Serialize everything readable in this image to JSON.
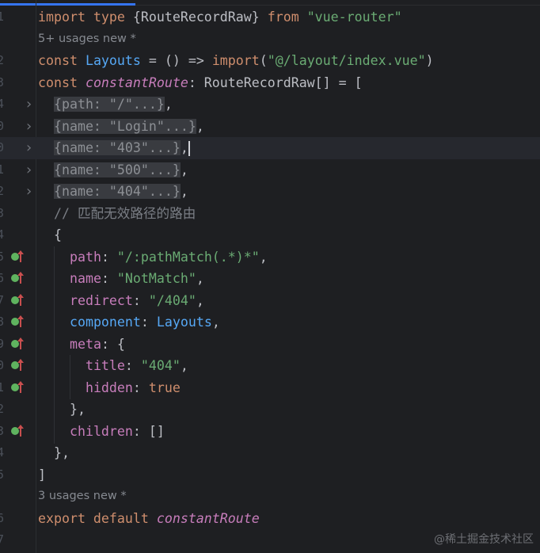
{
  "editor": {
    "colors": {
      "background": "#1e1f22",
      "keyword": "#cf8e6d",
      "string": "#6aab73",
      "property": "#c77dbb",
      "identifier": "#56a8f5",
      "text": "#bcbec4"
    },
    "lines": [
      {
        "ln": "1",
        "tokens": [
          [
            "import type ",
            "kw"
          ],
          [
            "{RouteRecordRaw} ",
            ""
          ],
          [
            "from ",
            "kw"
          ],
          [
            "\"vue-router\"",
            "str"
          ]
        ]
      },
      {
        "hint": "5+ usages   new *"
      },
      {
        "ln": "2",
        "tokens": [
          [
            "const ",
            "kw"
          ],
          [
            "Layouts",
            "fn"
          ],
          [
            " = () => ",
            ""
          ],
          [
            "import",
            "kw"
          ],
          [
            "(",
            ""
          ],
          [
            "\"@/layout/index.vue\"",
            "str"
          ],
          [
            ")",
            ""
          ]
        ]
      },
      {
        "ln": "3",
        "tokens": [
          [
            "const ",
            "kw"
          ],
          [
            "constantRoute",
            "ital"
          ],
          [
            ": RouteRecordRaw[] = [",
            ""
          ]
        ]
      },
      {
        "ln": "4",
        "fold": true,
        "tokens": [
          [
            "  ",
            ""
          ],
          [
            "{path: \"/\"...}",
            "fold-block"
          ],
          [
            ",",
            ""
          ]
        ]
      },
      {
        "ln": "0",
        "fold": true,
        "tokens": [
          [
            "  ",
            ""
          ],
          [
            "{name: \"Login\"...}",
            "fold-block"
          ],
          [
            ",",
            ""
          ]
        ]
      },
      {
        "ln": "0",
        "fold": true,
        "current": true,
        "caret": true,
        "tokens": [
          [
            "  ",
            ""
          ],
          [
            "{name: \"403\"...}",
            "fold-block"
          ],
          [
            ",",
            ""
          ]
        ]
      },
      {
        "ln": "1",
        "fold": true,
        "tokens": [
          [
            "  ",
            ""
          ],
          [
            "{name: \"500\"...}",
            "fold-block"
          ],
          [
            ",",
            ""
          ]
        ]
      },
      {
        "ln": "2",
        "fold": true,
        "tokens": [
          [
            "  ",
            ""
          ],
          [
            "{name: \"404\"...}",
            "fold-block"
          ],
          [
            ",",
            ""
          ]
        ]
      },
      {
        "ln": "3",
        "tokens": [
          [
            "  // 匹配无效路径的路由",
            "cm"
          ]
        ]
      },
      {
        "ln": "4",
        "tokens": [
          [
            "  {",
            ""
          ]
        ]
      },
      {
        "ln": "5",
        "impl": true,
        "tokens": [
          [
            "    ",
            ""
          ],
          [
            "path",
            "prop"
          ],
          [
            ": ",
            ""
          ],
          [
            "\"/:pathMatch(.*)*\"",
            "str"
          ],
          [
            ",",
            ""
          ]
        ]
      },
      {
        "ln": "6",
        "impl": true,
        "tokens": [
          [
            "    ",
            ""
          ],
          [
            "name",
            "prop"
          ],
          [
            ": ",
            ""
          ],
          [
            "\"NotMatch\"",
            "str"
          ],
          [
            ",",
            ""
          ]
        ]
      },
      {
        "ln": "7",
        "impl": true,
        "tokens": [
          [
            "    ",
            ""
          ],
          [
            "redirect",
            "prop"
          ],
          [
            ": ",
            ""
          ],
          [
            "\"/404\"",
            "str"
          ],
          [
            ",",
            ""
          ]
        ]
      },
      {
        "ln": "8",
        "impl": true,
        "tokens": [
          [
            "    ",
            ""
          ],
          [
            "component",
            "fn"
          ],
          [
            ": ",
            ""
          ],
          [
            "Layouts",
            "fn"
          ],
          [
            ",",
            ""
          ]
        ]
      },
      {
        "ln": "9",
        "impl": true,
        "tokens": [
          [
            "    ",
            ""
          ],
          [
            "meta",
            "prop"
          ],
          [
            ": {",
            ""
          ]
        ]
      },
      {
        "ln": "0",
        "impl": true,
        "tokens": [
          [
            "      ",
            ""
          ],
          [
            "title",
            "prop"
          ],
          [
            ": ",
            ""
          ],
          [
            "\"404\"",
            "str"
          ],
          [
            ",",
            ""
          ]
        ]
      },
      {
        "ln": "1",
        "impl": true,
        "tokens": [
          [
            "      ",
            ""
          ],
          [
            "hidden",
            "prop"
          ],
          [
            ": ",
            ""
          ],
          [
            "true",
            "kw"
          ]
        ]
      },
      {
        "ln": "2",
        "tokens": [
          [
            "    },",
            ""
          ]
        ]
      },
      {
        "ln": "3",
        "impl": true,
        "tokens": [
          [
            "    ",
            ""
          ],
          [
            "children",
            "prop"
          ],
          [
            ": []",
            ""
          ]
        ]
      },
      {
        "ln": "4",
        "tokens": [
          [
            "  },",
            ""
          ]
        ]
      },
      {
        "ln": "5",
        "tokens": [
          [
            "]",
            ""
          ]
        ]
      },
      {
        "hint": "3 usages   new *"
      },
      {
        "ln": "6",
        "tokens": [
          [
            "export default ",
            "kw"
          ],
          [
            "constantRoute",
            "ital"
          ]
        ]
      },
      {
        "ln": "7",
        "tokens": []
      }
    ]
  },
  "watermark": "@稀土掘金技术社区"
}
